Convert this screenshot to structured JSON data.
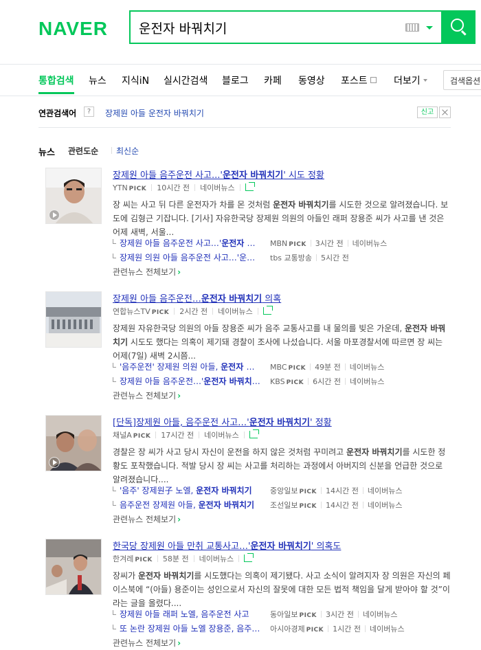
{
  "header": {
    "logo": "NAVER",
    "query": "운전자 바꿔치기"
  },
  "tabs": [
    {
      "label": "통합검색",
      "active": true
    },
    {
      "label": "뉴스"
    },
    {
      "label": "지식iN"
    },
    {
      "label": "실시간검색"
    },
    {
      "label": "블로그"
    },
    {
      "label": "카페"
    },
    {
      "label": "동영상"
    },
    {
      "label": "포스트"
    },
    {
      "label": "더보기"
    }
  ],
  "options_label": "검색옵션",
  "related": {
    "title": "연관검색어",
    "help": "?",
    "keyword": "장제원 아들 운전자 바꿔치기",
    "report": "신고"
  },
  "news_header": {
    "title": "뉴스",
    "relevance": "관련도순",
    "recent": "최신순"
  },
  "pick_label": "PICK",
  "naver_news": "네이버뉴스",
  "more_label": "관련뉴스 전체보기",
  "items": [
    {
      "title_pre": "장제원 아들 음주운전 사고...'",
      "title_hl": "운전자 바꿔치기",
      "title_post": "' 시도 정황",
      "press": "YTN",
      "time": "10시간 전",
      "desc_pre": "장 씨는 사고 뒤 다른 운전자가 차를 몬 것처럼 ",
      "desc_hl": "운전자 바꿔치기",
      "desc_post": "를 시도한 것으로 알려졌습니다. 보도에 김형근 기잡니다. [기사] 자유한국당 장제원 의원의 아들인 래퍼 장용준 씨가 사고를 낸 것은 어제 새벽, 서울...",
      "subs": [
        {
          "pre": "장제원 아들 음주운전 사고…'",
          "hl": "운전자 바꿔치기",
          "post": "",
          "press": "MBN",
          "pick": true,
          "time": "3시간 전",
          "naver": true
        },
        {
          "pre": "장제원 의원 아들 음주운전 사고…'운전자 바꿔치기'",
          "hl": "",
          "post": "",
          "press": "tbs 교통방송",
          "pick": false,
          "time": "5시간 전",
          "naver": false
        }
      ]
    },
    {
      "title_pre": "장제원 아들 음주운전…",
      "title_hl": "운전자 바꿔치기",
      "title_post": " 의혹",
      "press": "연합뉴스TV",
      "time": "2시간 전",
      "desc_pre": "장제원 자유한국당 의원의 아들 장용준 씨가 음주 교통사고를 내 물의를 빚은 가운데, ",
      "desc_hl": "운전자 바꿔치기",
      "desc_post": " 시도도 했다는 의혹이 제기돼 경찰이 조사에 나섰습니다. 서울 마포경찰서에 따르면 장 씨는 어제(7일) 새벽 2시쯤...",
      "subs": [
        {
          "pre": "'음주운전' 장제원 의원 아들, ",
          "hl": "운전자 바꿔치기",
          "post": "",
          "press": "MBC",
          "pick": true,
          "time": "49분 전",
          "naver": true
        },
        {
          "pre": "장제원 아들 음주운전…'",
          "hl": "운전자 바꿔치기",
          "post": "'",
          "press": "KBS",
          "pick": true,
          "time": "6시간 전",
          "naver": true
        }
      ]
    },
    {
      "title_pre": "[단독]장제원 아들, 음주운전 사고…'",
      "title_hl": "운전자 바꿔치기",
      "title_post": "' 정황",
      "press": "채널A",
      "time": "17시간 전",
      "desc_pre": "경찰은 장 씨가 사고 당시 자신이 운전을 하지 않은 것처럼 꾸미려고 ",
      "desc_hl": "운전자 바꿔치기",
      "desc_post": "를 시도한 정황도 포착했습니다. 적발 당시 장 씨는 사고를 처리하는 과정에서 아버지의 신분을 언급한 것으로 알려졌습니다....",
      "subs": [
        {
          "pre": "'음주' 장제원子 노엘, ",
          "hl": "운전자 바꿔치기",
          "post": "",
          "press": "중앙일보",
          "pick": true,
          "time": "14시간 전",
          "naver": true
        },
        {
          "pre": "음주운전 장제원 아들, ",
          "hl": "운전자 바꿔치기",
          "post": "",
          "press": "조선일보",
          "pick": true,
          "time": "14시간 전",
          "naver": true
        }
      ]
    },
    {
      "title_pre": "한국당 장제원 아들 만취 교통사고…'",
      "title_hl": "운전자 바꿔치기",
      "title_post": "' 의혹도",
      "press": "한겨레",
      "time": "58분 전",
      "desc_pre": "장씨가 ",
      "desc_hl": "운전자 바꿔치기",
      "desc_post": "를 시도했다는 의혹이 제기됐다. 사고 소식이 알려지자 장 의원은 자신의 페이스북에 “(아들) 용준이는 성인으로서 자신의 잘못에 대한 모든 법적 책임을 달게 받아야 할 것”이라는 글을 올렸다....",
      "subs": [
        {
          "pre": "장제원 아들 래퍼 노엘, 음주운전 사고",
          "hl": "",
          "post": "",
          "press": "동아일보",
          "pick": true,
          "time": "3시간 전",
          "naver": true
        },
        {
          "pre": "또 논란 장제원 아들 노엘 장용준, 음주운전",
          "hl": "",
          "post": "",
          "press": "아시아경제",
          "pick": true,
          "time": "1시간 전",
          "naver": true
        }
      ]
    }
  ]
}
